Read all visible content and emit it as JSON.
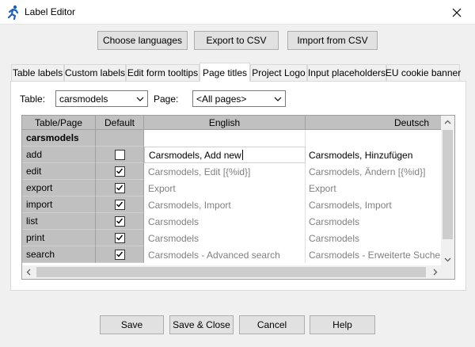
{
  "window": {
    "title": "Label Editor"
  },
  "top_buttons": {
    "choose_languages": "Choose languages",
    "export_csv": "Export to CSV",
    "import_csv": "Import from CSV"
  },
  "tabs": [
    {
      "label": "Table labels"
    },
    {
      "label": "Custom labels"
    },
    {
      "label": "Edit form tooltips"
    },
    {
      "label": "Page titles"
    },
    {
      "label": "Project Logo"
    },
    {
      "label": "Input placeholders"
    },
    {
      "label": "EU cookie banner"
    }
  ],
  "active_tab": "Page titles",
  "filters": {
    "table_label": "Table:",
    "table_value": "carsmodels",
    "page_label": "Page:",
    "page_value": "<All pages>"
  },
  "grid": {
    "headers": {
      "key": "Table/Page",
      "default": "Default",
      "lang1": "English",
      "lang2": "Deutsch"
    },
    "group": "carsmodels",
    "rows": [
      {
        "key": "add",
        "checked": false,
        "en": "Carsmodels, Add new",
        "de": "Carsmodels, Hinzufügen"
      },
      {
        "key": "edit",
        "checked": true,
        "en": "Carsmodels, Edit [{%id}]",
        "de": "Carsmodels, Ändern [{%id}]"
      },
      {
        "key": "export",
        "checked": true,
        "en": "Export",
        "de": "Export"
      },
      {
        "key": "import",
        "checked": true,
        "en": "Carsmodels, Import",
        "de": "Carsmodels, Import"
      },
      {
        "key": "list",
        "checked": true,
        "en": "Carsmodels",
        "de": "Carsmodels"
      },
      {
        "key": "print",
        "checked": true,
        "en": "Carsmodels",
        "de": "Carsmodels"
      },
      {
        "key": "search",
        "checked": true,
        "en": "Carsmodels - Advanced search",
        "de": "Carsmodels - Erweiterte Suche"
      }
    ]
  },
  "bottom_buttons": {
    "save": "Save",
    "save_close": "Save & Close",
    "cancel": "Cancel",
    "help": "Help"
  }
}
